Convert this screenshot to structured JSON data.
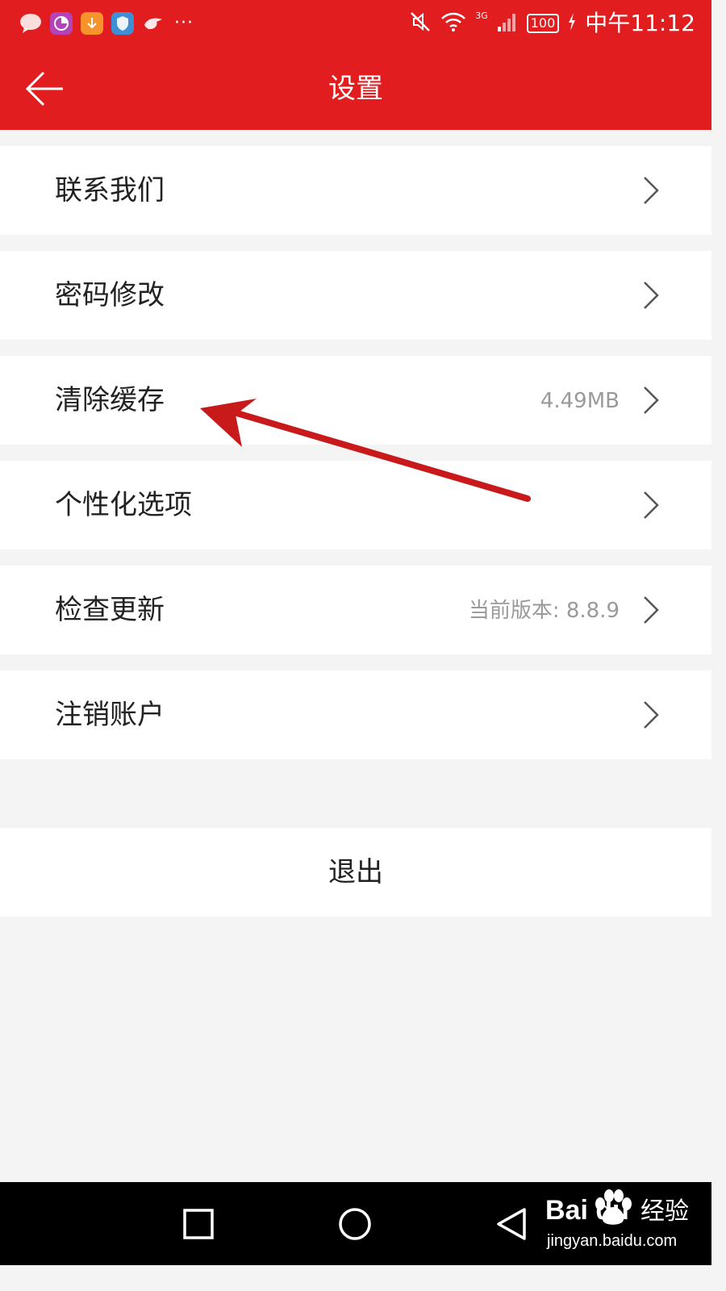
{
  "status_bar": {
    "time": "中午11:12",
    "battery": "100",
    "network": "3G",
    "more": "···",
    "icons": [
      "message-icon",
      "pie-chart-icon",
      "download-icon",
      "shield-icon",
      "bird-icon",
      "mute-icon",
      "wifi-icon",
      "signal-icon",
      "charging-icon"
    ]
  },
  "app_bar": {
    "title": "设置",
    "back_icon": "back-arrow-icon"
  },
  "settings": {
    "items": [
      {
        "label": "联系我们",
        "value": ""
      },
      {
        "label": "密码修改",
        "value": ""
      },
      {
        "label": "清除缓存",
        "value": "4.49MB"
      },
      {
        "label": "个性化选项",
        "value": ""
      },
      {
        "label": "检查更新",
        "value": "当前版本: 8.8.9"
      },
      {
        "label": "注销账户",
        "value": ""
      }
    ]
  },
  "logout": {
    "label": "退出"
  },
  "annotation": {
    "color": "#c8191b",
    "points_to": "清除缓存"
  },
  "nav_bar": {
    "icons": [
      "recent-apps-icon",
      "home-icon",
      "back-icon"
    ]
  },
  "watermark": {
    "brand": "Bai  du",
    "cn": "经验",
    "url": "jingyan.baidu.com"
  },
  "colors": {
    "accent": "#e11d1f",
    "background": "#f4f4f4",
    "row": "#ffffff",
    "secondary_text": "#9a9a9a"
  }
}
